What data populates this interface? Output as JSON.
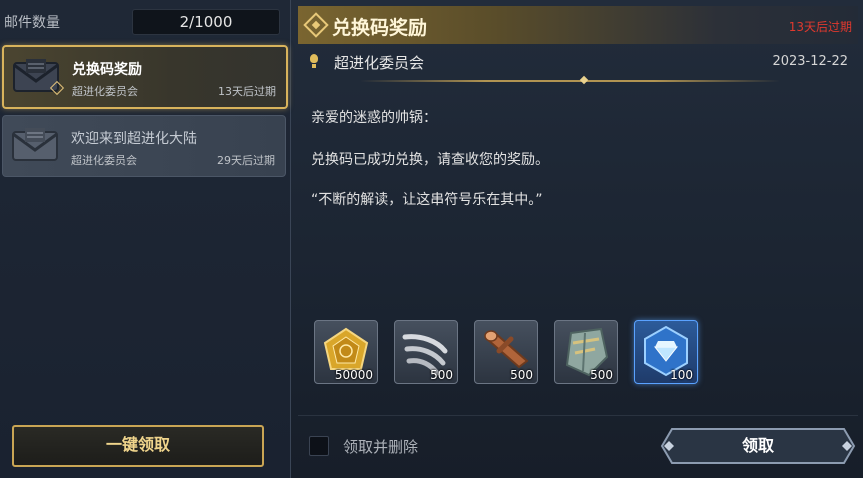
{
  "mailbox": {
    "count_label": "邮件数量",
    "count_value": "2/1000",
    "mails": [
      {
        "title": "兑换码奖励",
        "sender": "超进化委员会",
        "expiry": "13天后过期",
        "selected": true
      },
      {
        "title": "欢迎来到超进化大陆",
        "sender": "超进化委员会",
        "expiry": "29天后过期",
        "selected": false
      }
    ],
    "claim_all_label": "一键领取"
  },
  "detail": {
    "title": "兑换码奖励",
    "expiry": "13天后过期",
    "sender": "超进化委员会",
    "date": "2023-12-22",
    "body": [
      "亲爱的迷惑的帅锅：",
      "兑换码已成功兑换，请查收您的奖励。",
      "“不断的解读，让这串符号乐在其中。”"
    ],
    "rewards": [
      {
        "icon": "gold-coin-icon",
        "quantity": "50000"
      },
      {
        "icon": "claw-icon",
        "quantity": "500"
      },
      {
        "icon": "wood-log-icon",
        "quantity": "500"
      },
      {
        "icon": "stone-plate-icon",
        "quantity": "500"
      },
      {
        "icon": "blue-gem-icon",
        "quantity": "100"
      }
    ],
    "claim_and_delete_label": "领取并删除",
    "claim_label": "领取"
  },
  "colors": {
    "accent_gold": "#d8b35c",
    "expiry_red": "#e0392e",
    "panel_bg": "#1f2836"
  }
}
